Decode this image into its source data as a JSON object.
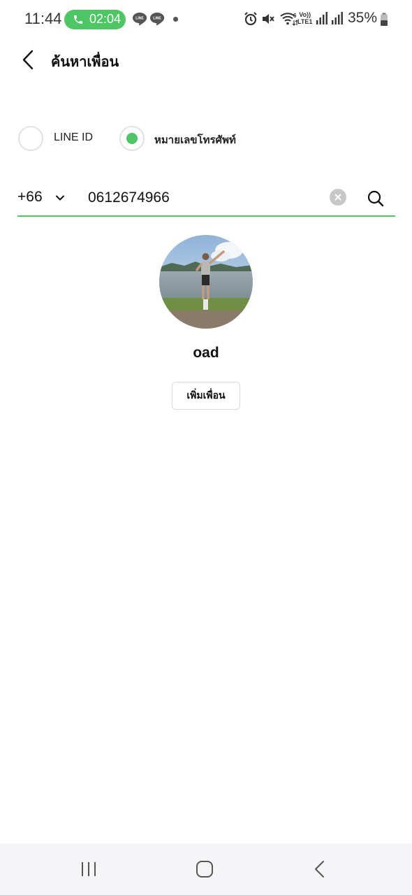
{
  "status_bar": {
    "time": "11:44",
    "call_timer": "02:04",
    "lte_label_top": "Vo))",
    "lte_label_bottom": "LTE1",
    "battery_percent": "35%",
    "icons": [
      "phone-icon",
      "line-notification-icon",
      "line-notification-icon",
      "alarm-icon",
      "mute-icon",
      "wifi-icon",
      "signal-icon",
      "signal-icon",
      "battery-icon"
    ]
  },
  "header": {
    "title": "ค้นหาเพื่อน",
    "back_icon": "chevron-left-icon"
  },
  "search_type": {
    "options": [
      {
        "label": "LINE ID",
        "selected": false
      },
      {
        "label": "หมายเลขโทรศัพท์",
        "selected": true
      }
    ],
    "accent_color": "#4cc764"
  },
  "phone_search": {
    "country_code": "+66",
    "phone_number": "0612674966"
  },
  "result": {
    "name": "oad",
    "add_button_label": "เพิ่มเพื่อน"
  },
  "nav_bar": {
    "buttons": [
      "recent-apps-icon",
      "home-icon",
      "back-icon"
    ]
  }
}
